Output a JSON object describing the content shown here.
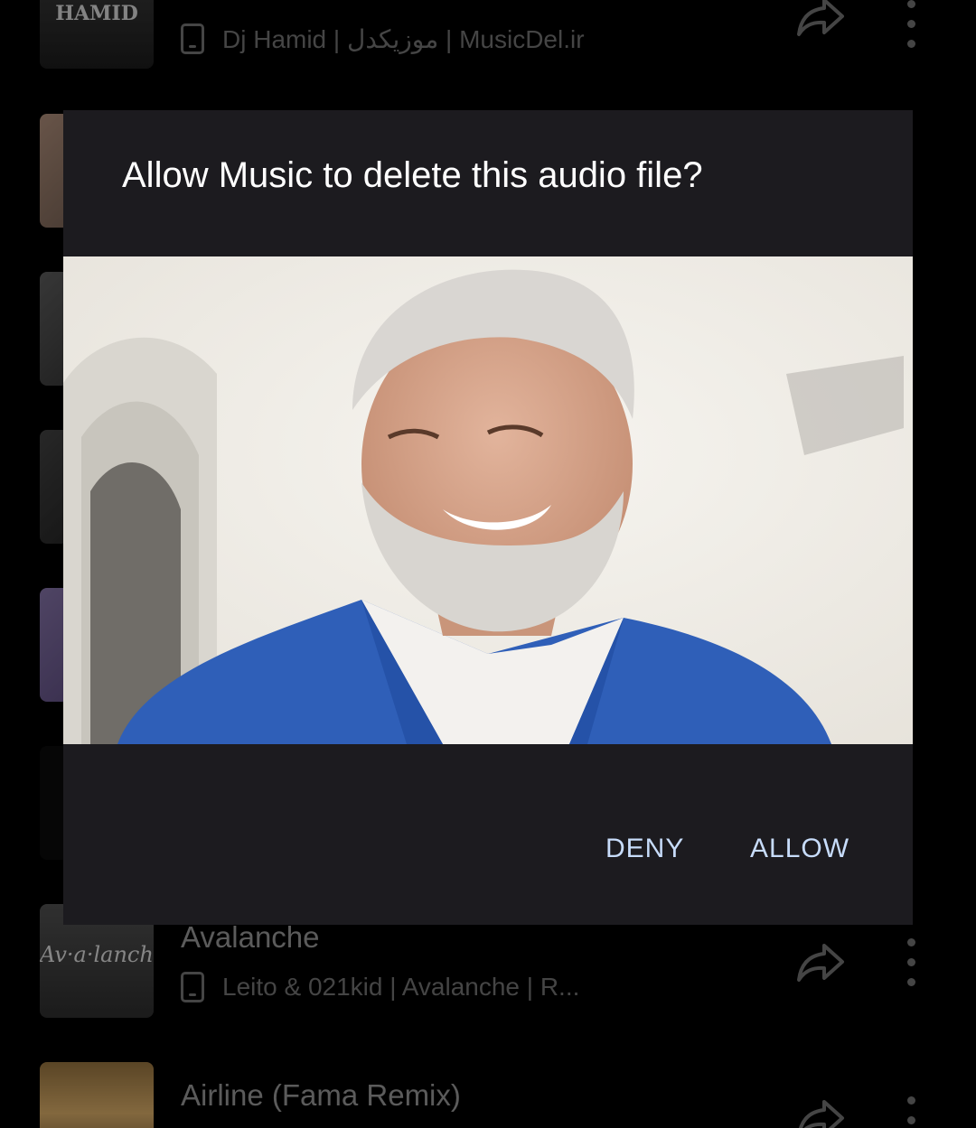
{
  "tracks": [
    {
      "title": "",
      "subtitle": "Dj Hamid | موزیکدل | MusicDel.ir",
      "thumb_text": "HAMID"
    },
    {
      "title": "",
      "subtitle": ""
    },
    {
      "title": "",
      "subtitle": ""
    },
    {
      "title": "",
      "subtitle": ""
    },
    {
      "title": "",
      "subtitle": ""
    },
    {
      "title": "",
      "subtitle": ""
    },
    {
      "title": "Avalanche",
      "subtitle": "Leito & 021kid | Avalanche | R...",
      "thumb_text": "Av·a·lanche"
    },
    {
      "title": "Airline (Fama Remix)",
      "subtitle": ""
    }
  ],
  "dialog": {
    "title": "Allow Music to delete this audio file?",
    "deny_label": "DENY",
    "allow_label": "ALLOW",
    "accent_color": "#c7dcfa"
  },
  "icons": {
    "share": "share-icon",
    "more": "more-vert-icon",
    "storage": "phone-storage-icon"
  }
}
